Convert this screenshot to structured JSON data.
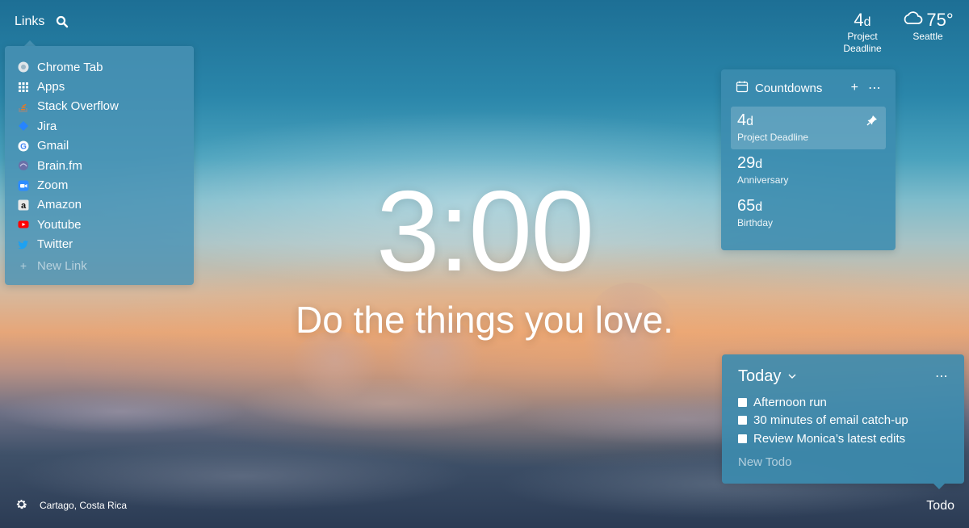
{
  "links": {
    "title": "Links",
    "items": [
      {
        "label": "Chrome Tab",
        "icon": "chrome-icon",
        "color": "#dfe6ea"
      },
      {
        "label": "Apps",
        "icon": "apps-grid-icon",
        "color": "#ffffff"
      },
      {
        "label": "Stack Overflow",
        "icon": "stack-overflow-icon",
        "color": "#b07a4a"
      },
      {
        "label": "Jira",
        "icon": "jira-icon",
        "color": "#2684ff"
      },
      {
        "label": "Gmail",
        "icon": "google-icon",
        "color": "#ffffff"
      },
      {
        "label": "Brain.fm",
        "icon": "brainfm-icon",
        "color": "#6a6fa8"
      },
      {
        "label": "Zoom",
        "icon": "zoom-icon",
        "color": "#2d8cff"
      },
      {
        "label": "Amazon",
        "icon": "amazon-icon",
        "color": "#232f3e"
      },
      {
        "label": "Youtube",
        "icon": "youtube-icon",
        "color": "#ff0000"
      },
      {
        "label": "Twitter",
        "icon": "twitter-icon",
        "color": "#1da1f2"
      }
    ],
    "new_link": "New Link"
  },
  "top_countdown": {
    "number": "4",
    "unit": "d",
    "label_line1": "Project",
    "label_line2": "Deadline"
  },
  "weather": {
    "temp": "75°",
    "location": "Seattle"
  },
  "countdowns": {
    "title": "Countdowns",
    "items": [
      {
        "number": "4",
        "unit": "d",
        "label": "Project Deadline",
        "active": true
      },
      {
        "number": "29",
        "unit": "d",
        "label": "Anniversary"
      },
      {
        "number": "65",
        "unit": "d",
        "label": "Birthday"
      }
    ]
  },
  "clock": "3:00",
  "mantra": "Do the things you love.",
  "todo": {
    "title": "Today",
    "items": [
      "Afternoon run",
      "30 minutes of email catch-up",
      "Review Monica’s latest edits"
    ],
    "new_todo": "New Todo",
    "button": "Todo"
  },
  "location": "Cartago, Costa Rica"
}
